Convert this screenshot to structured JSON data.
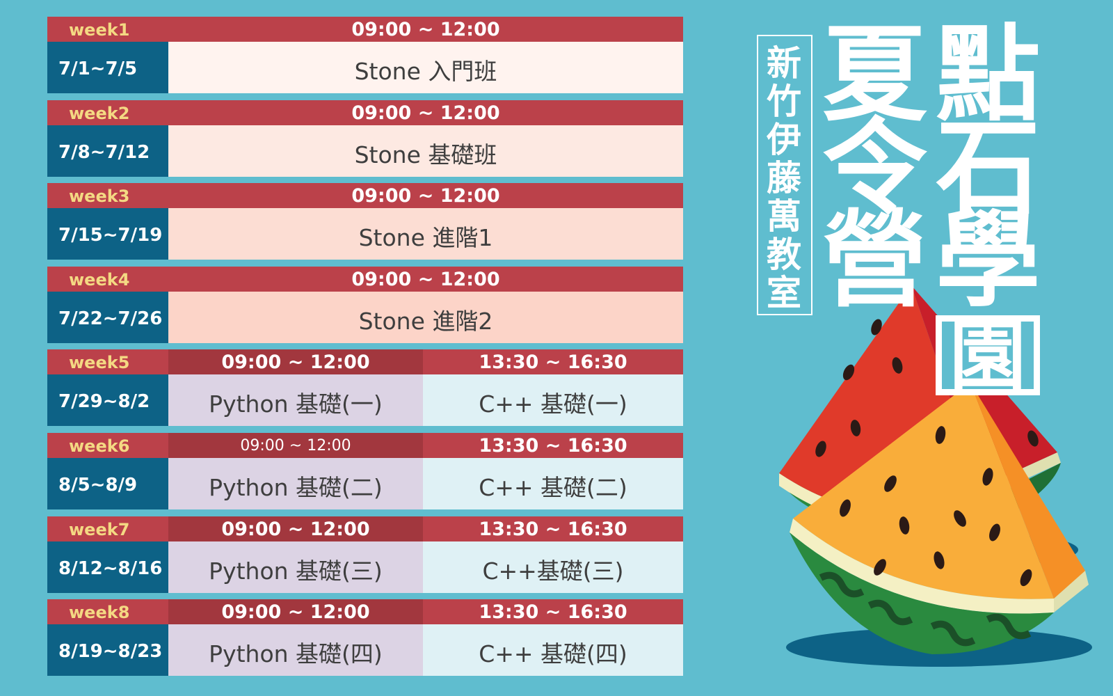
{
  "weeks": [
    {
      "label": "week1",
      "date": "7/1~7/5",
      "time": "09:00 ~ 12:00",
      "course": "Stone 入門班",
      "bg": "#fff3ef"
    },
    {
      "label": "week2",
      "date": "7/8~7/12",
      "time": "09:00 ~ 12:00",
      "course": "Stone 基礎班",
      "bg": "#fde9e2"
    },
    {
      "label": "week3",
      "date": "7/15~7/19",
      "time": "09:00 ~ 12:00",
      "course": "Stone 進階1",
      "bg": "#fcddd3"
    },
    {
      "label": "week4",
      "date": "7/22~7/26",
      "time": "09:00 ~ 12:00",
      "course": "Stone 進階2",
      "bg": "#fcd4c8"
    },
    {
      "label": "week5",
      "date": "7/29~8/2",
      "time_am": "09:00 ~ 12:00",
      "time_pm": "13:30 ~ 16:30",
      "course_am": "Python 基礎(一)",
      "course_pm": "C++ 基礎(一)"
    },
    {
      "label": "week6",
      "date": "8/5~8/9",
      "time_am": "09:00 ~ 12:00",
      "time_pm": "13:30 ~ 16:30",
      "course_am": "Python 基礎(二)",
      "course_pm": "C++ 基礎(二)"
    },
    {
      "label": "week7",
      "date": "8/12~8/16",
      "time_am": "09:00 ~ 12:00",
      "time_pm": "13:30 ~ 16:30",
      "course_am": "Python 基礎(三)",
      "course_pm": "C++基礎(三)"
    },
    {
      "label": "week8",
      "date": "8/19~8/23",
      "time_am": "09:00 ~ 12:00",
      "time_pm": "13:30 ~ 16:30",
      "course_am": "Python 基礎(四)",
      "course_pm": "C++ 基礎(四)"
    }
  ],
  "subtitle": "新竹伊藤萬教室",
  "title": {
    "col_left": [
      "夏",
      "令",
      "營"
    ],
    "col_right": [
      "點",
      "石",
      "學"
    ],
    "boxed": "園"
  },
  "colors": {
    "background": "#5fbdcf",
    "header_bar": "#bb414a",
    "date_cell": "#0d6286",
    "week_label": "#f4d983"
  },
  "icons": [
    "watermelon-slices"
  ]
}
